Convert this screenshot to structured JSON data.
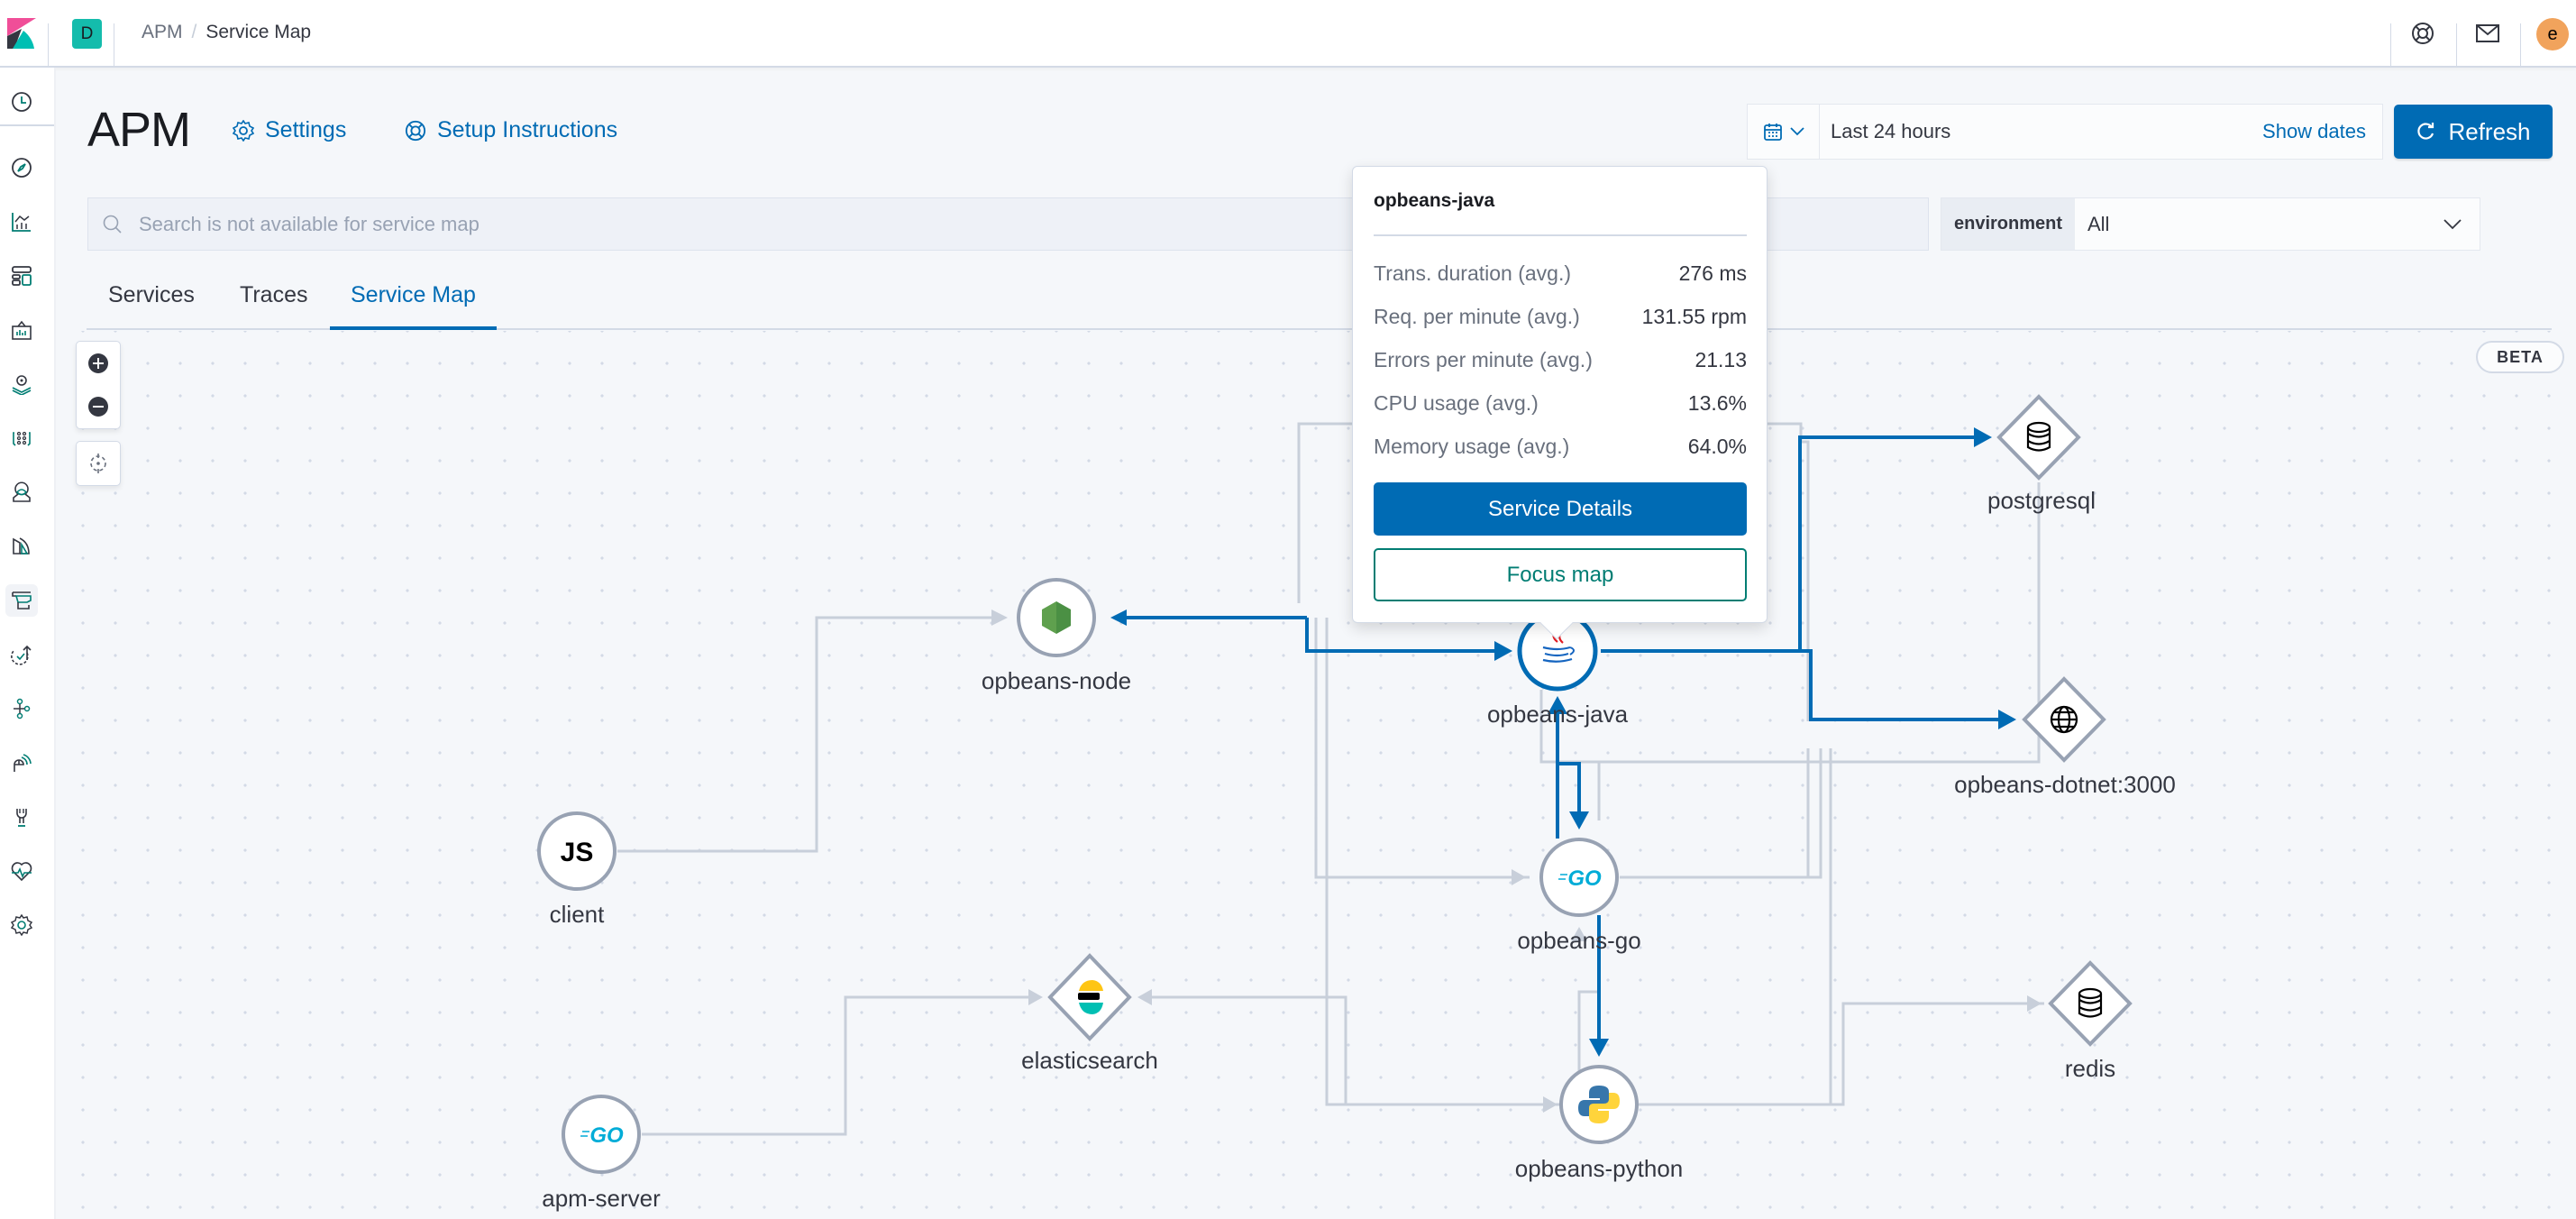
{
  "header": {
    "space_initial": "D",
    "breadcrumbs": [
      "APM",
      "Service Map"
    ],
    "breadcrumb_separator": "/",
    "user_initial": "e",
    "icons": [
      "help-icon",
      "newsfeed-icon"
    ]
  },
  "sidebar": {
    "items": [
      {
        "name": "recently-viewed",
        "icon": "clock-icon"
      },
      {
        "name": "discover",
        "icon": "compass-icon"
      },
      {
        "name": "visualize",
        "icon": "visualize-icon"
      },
      {
        "name": "dashboard",
        "icon": "dashboard-icon"
      },
      {
        "name": "canvas",
        "icon": "canvas-icon"
      },
      {
        "name": "maps",
        "icon": "maps-icon"
      },
      {
        "name": "machine-learning",
        "icon": "ml-icon"
      },
      {
        "name": "infrastructure",
        "icon": "infrastructure-icon"
      },
      {
        "name": "logs",
        "icon": "logs-icon"
      },
      {
        "name": "apm",
        "icon": "apm-icon",
        "active": true
      },
      {
        "name": "uptime",
        "icon": "uptime-icon"
      },
      {
        "name": "graph",
        "icon": "graph-icon"
      },
      {
        "name": "siem",
        "icon": "siem-icon"
      },
      {
        "name": "dev-tools",
        "icon": "dev-tools-icon"
      },
      {
        "name": "stack-monitoring",
        "icon": "monitoring-icon"
      },
      {
        "name": "management",
        "icon": "gear-icon"
      }
    ]
  },
  "page": {
    "title": "APM",
    "settings_label": "Settings",
    "setup_label": "Setup Instructions"
  },
  "datepicker": {
    "value": "Last 24 hours",
    "show_dates_label": "Show dates",
    "refresh_label": "Refresh"
  },
  "search": {
    "placeholder": "Search is not available for service map"
  },
  "environment": {
    "label": "environment",
    "value": "All"
  },
  "tabs": [
    {
      "label": "Services",
      "active": false
    },
    {
      "label": "Traces",
      "active": false
    },
    {
      "label": "Service Map",
      "active": true
    }
  ],
  "map": {
    "badge": "BETA",
    "controls": [
      "zoom-in",
      "zoom-out",
      "center"
    ],
    "colors": {
      "highlight": "#006bb4",
      "edge": "#c8cfda",
      "node_border": "#98a2b3"
    },
    "nodes": [
      {
        "id": "opbeans-node",
        "label": "opbeans-node",
        "type": "service",
        "agent": "nodejs"
      },
      {
        "id": "opbeans-java",
        "label": "opbeans-java",
        "type": "service",
        "agent": "java",
        "selected": true
      },
      {
        "id": "postgresql",
        "label": "postgresql",
        "type": "external",
        "subtype": "database"
      },
      {
        "id": "opbeans-dotnet",
        "label": "opbeans-dotnet:3000",
        "type": "external",
        "subtype": "http"
      },
      {
        "id": "client",
        "label": "client",
        "type": "service",
        "agent": "js-base"
      },
      {
        "id": "opbeans-go",
        "label": "opbeans-go",
        "type": "service",
        "agent": "go"
      },
      {
        "id": "elasticsearch",
        "label": "elasticsearch",
        "type": "external",
        "subtype": "elasticsearch"
      },
      {
        "id": "redis",
        "label": "redis",
        "type": "external",
        "subtype": "database"
      },
      {
        "id": "apm-server",
        "label": "apm-server",
        "type": "service",
        "agent": "go"
      },
      {
        "id": "opbeans-python",
        "label": "opbeans-python",
        "type": "service",
        "agent": "python"
      }
    ],
    "edges": [
      {
        "from": "client",
        "to": "opbeans-node",
        "highlighted": false
      },
      {
        "from": "opbeans-java",
        "to": "opbeans-node",
        "highlighted": true
      },
      {
        "from": "opbeans-node",
        "to": "opbeans-java",
        "highlighted": true
      },
      {
        "from": "opbeans-java",
        "to": "postgresql",
        "highlighted": true
      },
      {
        "from": "opbeans-java",
        "to": "opbeans-dotnet",
        "highlighted": true
      },
      {
        "from": "opbeans-java",
        "to": "opbeans-go",
        "highlighted": true
      },
      {
        "from": "opbeans-go",
        "to": "opbeans-java",
        "highlighted": true
      },
      {
        "from": "opbeans-go",
        "to": "opbeans-python",
        "highlighted": true
      },
      {
        "from": "apm-server",
        "to": "elasticsearch",
        "highlighted": false
      },
      {
        "from": "opbeans-python",
        "to": "elasticsearch",
        "highlighted": false
      },
      {
        "from": "opbeans-python",
        "to": "redis",
        "highlighted": false
      },
      {
        "from": "opbeans-node",
        "to": "opbeans-go",
        "highlighted": false
      },
      {
        "from": "opbeans-node",
        "to": "opbeans-python",
        "highlighted": false
      },
      {
        "from": "opbeans-python",
        "to": "opbeans-go",
        "highlighted": false
      },
      {
        "from": "opbeans-dotnet",
        "to": "postgresql",
        "highlighted": false
      }
    ]
  },
  "popover": {
    "title": "opbeans-java",
    "metrics": [
      {
        "label": "Trans. duration (avg.)",
        "value": "276 ms"
      },
      {
        "label": "Req. per minute (avg.)",
        "value": "131.55 rpm"
      },
      {
        "label": "Errors per minute (avg.)",
        "value": "21.13"
      },
      {
        "label": "CPU usage (avg.)",
        "value": "13.6%"
      },
      {
        "label": "Memory usage (avg.)",
        "value": "64.0%"
      }
    ],
    "primary_button": "Service Details",
    "secondary_button": "Focus map"
  }
}
